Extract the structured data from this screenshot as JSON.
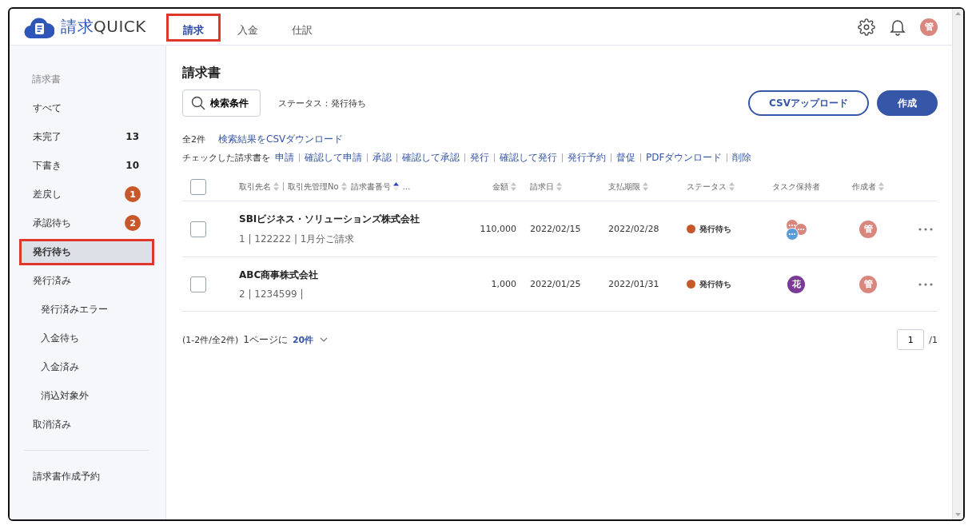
{
  "header": {
    "logo": {
      "first": "請求",
      "second": "QUICK"
    },
    "tabs": [
      {
        "label": "請求",
        "selected": true
      },
      {
        "label": "入金",
        "selected": false
      },
      {
        "label": "仕訳",
        "selected": false
      }
    ],
    "user_initial": "管"
  },
  "sidebar": {
    "section": "請求書",
    "items": [
      {
        "label": "すべて",
        "kind": "plain",
        "selected": false
      },
      {
        "label": "未完了",
        "kind": "count",
        "count": "13",
        "selected": false
      },
      {
        "label": "下書き",
        "kind": "count",
        "count": "10",
        "selected": false
      },
      {
        "label": "差戻し",
        "kind": "badge",
        "count": "1",
        "selected": false
      },
      {
        "label": "承認待ち",
        "kind": "badge",
        "count": "2",
        "selected": false
      },
      {
        "label": "発行待ち",
        "kind": "plain",
        "selected": true
      },
      {
        "label": "発行済み",
        "kind": "plain",
        "selected": false,
        "children": [
          {
            "label": "発行済みエラー",
            "selected": false
          },
          {
            "label": "入金待ち",
            "selected": false
          },
          {
            "label": "入金済み",
            "selected": false
          },
          {
            "label": "消込対象外",
            "selected": false
          }
        ]
      },
      {
        "label": "取消済み",
        "kind": "plain",
        "selected": false
      }
    ],
    "footer_items": [
      {
        "label": "請求書作成予約",
        "selected": false
      }
    ]
  },
  "main": {
    "title": "請求書",
    "search_button": "検索条件",
    "filter": "ステータス：発行待ち",
    "buttons": [
      {
        "label": "CSVアップロード",
        "kind": "outline"
      },
      {
        "label": "作成",
        "kind": "primary"
      }
    ],
    "total": "全2件",
    "download_link": "検索結果をCSVダウンロード",
    "bulk_label": "チェックした請求書を",
    "bulk_actions": [
      "申請",
      "確認して申請",
      "承認",
      "確認して承認",
      "発行",
      "確認して発行",
      "発行予約",
      "督促",
      "PDFダウンロード",
      "削除"
    ],
    "table": {
      "select_all_checked": false,
      "columns": [
        {
          "label": "取引先名",
          "sortable": true,
          "sorted": false
        },
        {
          "label": "取引先管理No",
          "sortable": true,
          "sorted": false
        },
        {
          "label": "請求書番号",
          "sortable": true,
          "sorted": true
        },
        {
          "label": "…",
          "sortable": false
        },
        {
          "label": "金額",
          "sortable": true,
          "sorted": false
        },
        {
          "label": "請求日",
          "sortable": true,
          "sorted": false
        },
        {
          "label": "支払期限",
          "sortable": true,
          "sorted": false
        },
        {
          "label": "ステータス",
          "sortable": true,
          "sorted": false
        },
        {
          "label": "タスク保持者",
          "sortable": false
        },
        {
          "label": "作成者",
          "sortable": true,
          "sorted": false
        }
      ],
      "rows": [
        {
          "checked": false,
          "name": "SBIビジネス・ソリューションズ株式会社",
          "sub": "1 | 122222 | 1月分ご請求",
          "amount": "110,000",
          "date": "2022/02/15",
          "due": "2022/02/28",
          "status": "発行待ち",
          "color": "#c8582a",
          "holders": [
            {
              "kind": "dots",
              "color": "#d9867e"
            },
            {
              "kind": "dots",
              "color": "#d9867e"
            },
            {
              "kind": "dots",
              "color": "#5b9bd5"
            }
          ],
          "creator": "管"
        },
        {
          "checked": false,
          "name": "ABC商事株式会社",
          "sub": "2 | 1234599 |",
          "amount": "1,000",
          "date": "2022/01/25",
          "due": "2022/01/31",
          "status": "発行待ち",
          "color": "#c8582a",
          "holders": [
            {
              "kind": "initial",
              "label": "花",
              "color": "#7b3a96"
            }
          ],
          "creator": "管"
        }
      ]
    },
    "pagination": {
      "range": "(1-2件/全2件)",
      "per_page_label": "1ページに",
      "per_page": "20件",
      "page": "1",
      "pages": "/1"
    }
  }
}
